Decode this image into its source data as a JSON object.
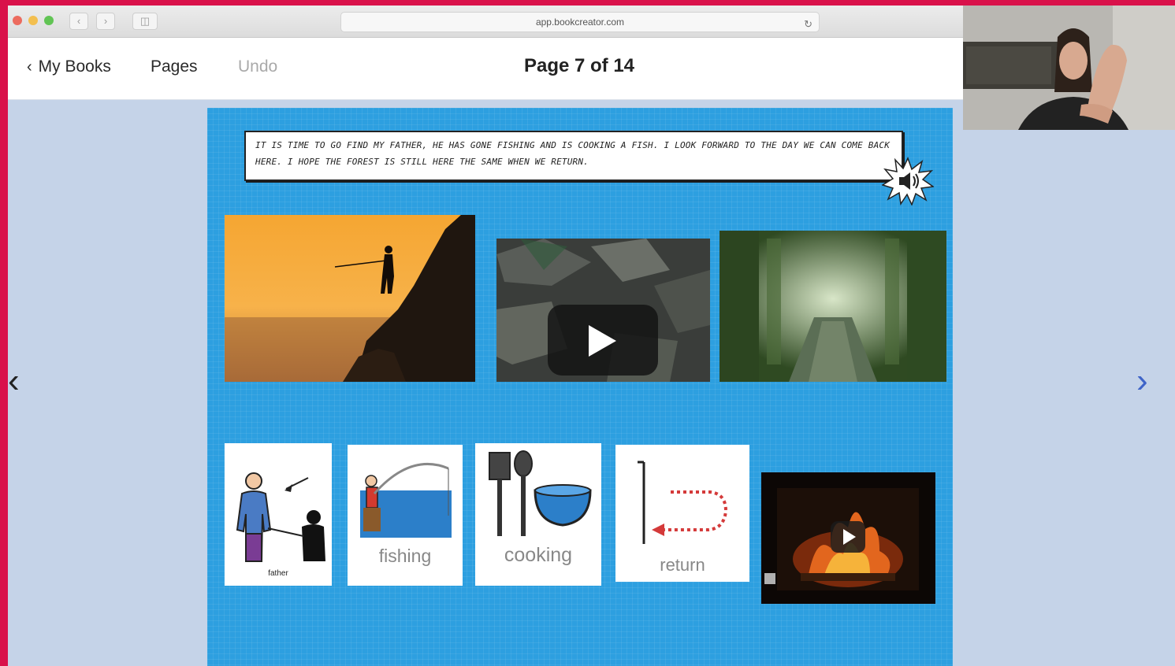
{
  "browser": {
    "url": "app.bookcreator.com",
    "back_icon": "chevron-left-icon",
    "forward_icon": "chevron-right-icon",
    "sidebar_icon": "sidebar-icon",
    "reload_icon": "reload-icon"
  },
  "toolbar": {
    "back_label": "My Books",
    "pages_label": "Pages",
    "undo_label": "Undo",
    "page_title": "Page 7 of 14"
  },
  "page": {
    "narration": "It is time to go find my father, he has gone fishing and is cooking a fish. I look forward to the day we can come back here. I hope the forest is still here the same when we return.",
    "audio_icon": "speaker-icon",
    "photos": [
      "fisherman-silhouette",
      "rocks-video",
      "forest-path"
    ],
    "symbols": [
      {
        "label": "father",
        "icon": "father-child-icon"
      },
      {
        "label": "fishing",
        "icon": "fishing-icon"
      },
      {
        "label": "cooking",
        "icon": "cooking-utensils-icon"
      },
      {
        "label": "return",
        "icon": "return-arrow-icon"
      }
    ],
    "fireplace_video": "fireplace-video"
  },
  "colors": {
    "page_bg": "#2d9fe0",
    "accent_arrow": "#3f64c8",
    "frame": "#d9114a"
  }
}
